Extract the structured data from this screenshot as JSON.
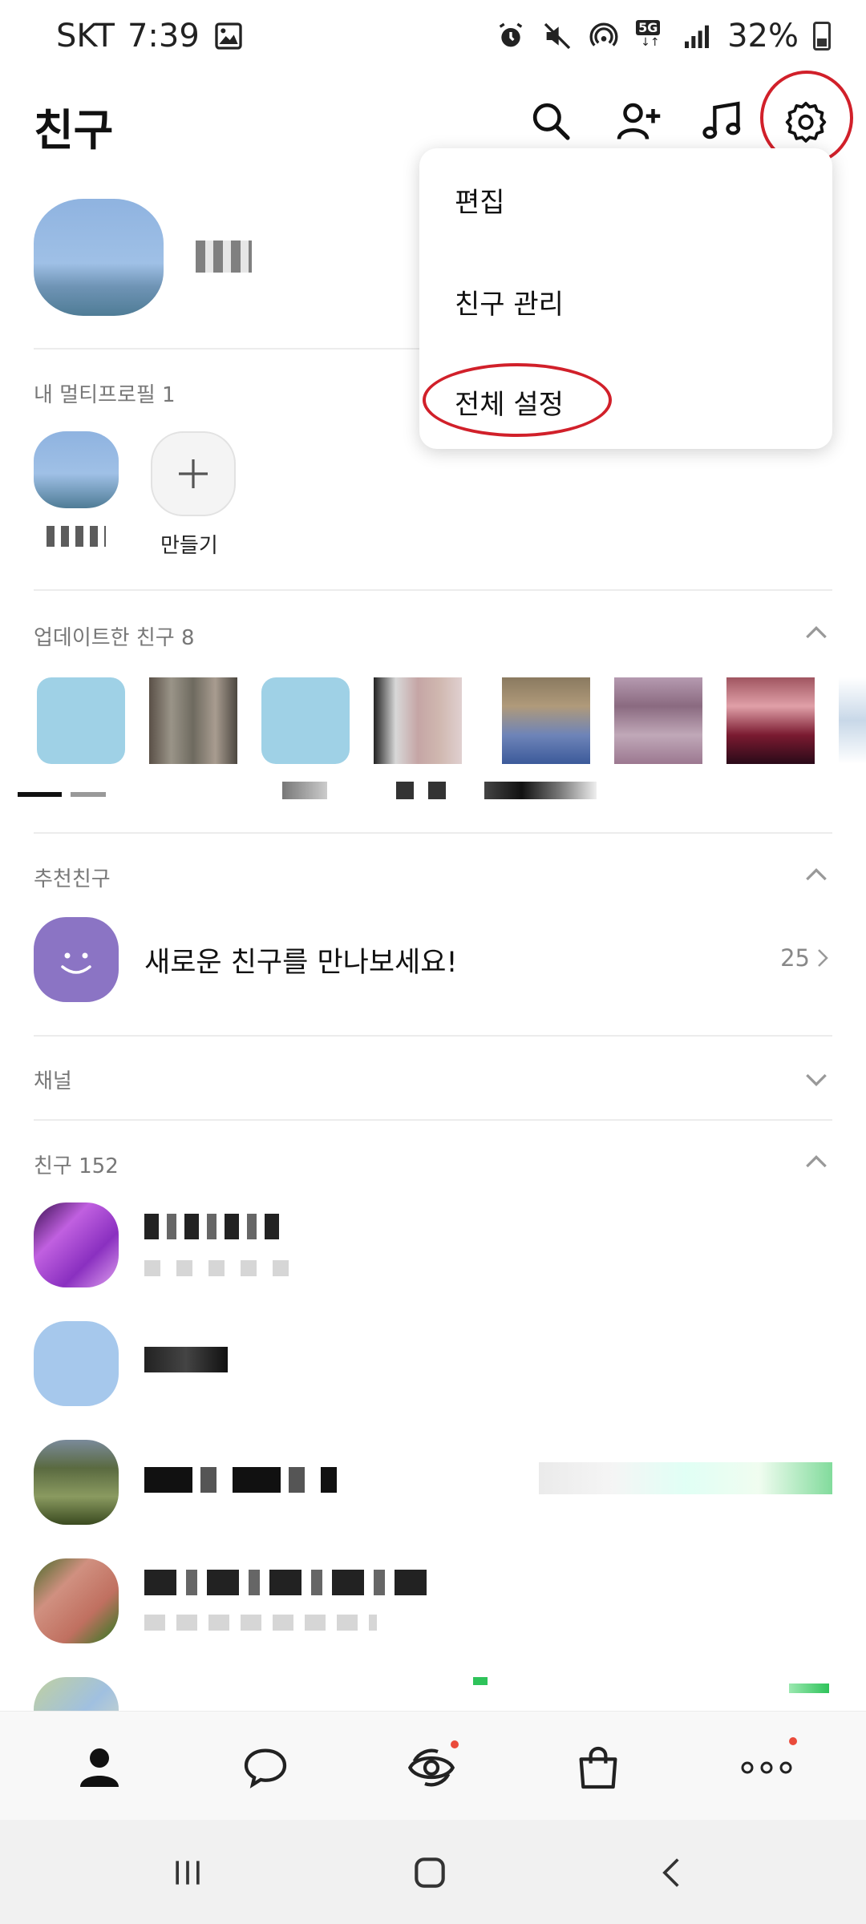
{
  "status_bar": {
    "carrier": "SKT",
    "time": "7:39",
    "battery": "32%",
    "network": "5G",
    "icons": [
      "image-icon",
      "alarm-icon",
      "mute-icon",
      "hotspot-icon",
      "5g-icon",
      "signal-icon",
      "battery-icon"
    ]
  },
  "header": {
    "title": "친구",
    "icons": [
      "search-icon",
      "add-friend-icon",
      "music-icon",
      "settings-icon"
    ]
  },
  "dropdown_menu": {
    "items": [
      "편집",
      "친구 관리",
      "전체 설정"
    ],
    "highlighted": "전체 설정"
  },
  "multi_profile": {
    "title": "내 멀티프로필 1",
    "create_label": "만들기"
  },
  "updated_friends": {
    "title": "업데이트한 친구 8"
  },
  "recommended": {
    "title": "추천친구",
    "text": "새로운 친구를 만나보세요!",
    "count": "25"
  },
  "channel": {
    "title": "채널"
  },
  "friends": {
    "title": "친구 152"
  },
  "bottom_nav": {
    "items": [
      "friends-tab-icon",
      "chat-tab-icon",
      "view-tab-icon",
      "shopping-tab-icon",
      "more-tab-icon"
    ]
  },
  "colors": {
    "accent_red": "#d1202a",
    "recommend_purple": "#8b74c4",
    "badge": "#ea4b3b"
  }
}
